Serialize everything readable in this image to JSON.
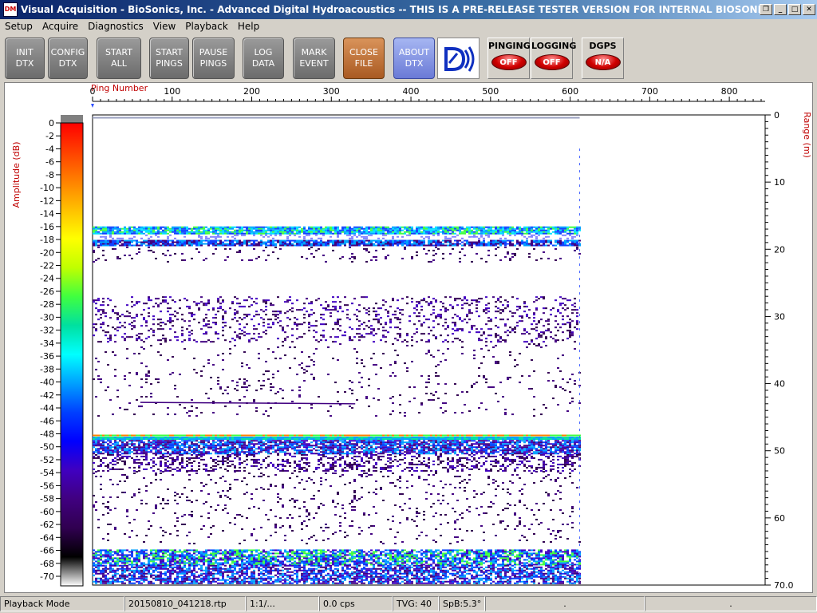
{
  "window": {
    "icon_text": "DM",
    "title": "Visual Acquisition  -  BioSonics, Inc.  -  Advanced Digital Hydroacoustics  -- THIS IS A PRE-RELEASE TESTER VERSION FOR INTERNAL BIOSONICS USE ONLY",
    "buttons": {
      "restore": "❐",
      "minimize": "_",
      "maximize": "□",
      "close": "✕"
    }
  },
  "menu": [
    "Setup",
    "Acquire",
    "Diagnostics",
    "View",
    "Playback",
    "Help"
  ],
  "toolbar": {
    "init": "INIT\nDTX",
    "config": "CONFIG\nDTX",
    "start_all": "START\nALL",
    "start_pings": "START\nPINGS",
    "pause_pings": "PAUSE\nPINGS",
    "log_data": "LOG\nDATA",
    "mark_event": "MARK\nEVENT",
    "close_file": "CLOSE\nFILE",
    "about": "ABOUT\nDTX",
    "pinging": {
      "label": "PINGING",
      "state": "OFF"
    },
    "logging": {
      "label": "LOGGING",
      "state": "OFF"
    },
    "dgps": {
      "label": "DGPS",
      "state": "N/A"
    }
  },
  "echogram": {
    "x_axis_title": "Ping Number",
    "x_ticks": [
      "0",
      "100",
      "200",
      "300",
      "400",
      "500",
      "600",
      "700",
      "800"
    ],
    "x_range": [
      0,
      845
    ],
    "pings_recorded": 612,
    "range_axis_title": "Range (m)",
    "range_ticks": [
      "0",
      "10",
      "20",
      "30",
      "40",
      "50",
      "60",
      "70.0"
    ],
    "range_range": [
      0,
      70
    ],
    "amp_axis_title": "Amplitude (dB)",
    "amp_ticks": [
      "0",
      "-2",
      "-4",
      "-6",
      "-8",
      "-10",
      "-12",
      "-14",
      "-16",
      "-18",
      "-20",
      "-22",
      "-24",
      "-26",
      "-28",
      "-30",
      "-32",
      "-34",
      "-36",
      "-38",
      "-40",
      "-42",
      "-44",
      "-46",
      "-48",
      "-50",
      "-52",
      "-54",
      "-56",
      "-58",
      "-60",
      "-62",
      "-64",
      "-66",
      "-68",
      "-70"
    ],
    "amp_range": [
      0,
      -70
    ],
    "colors": {
      "scale": [
        "#ff0000",
        "#ff4000",
        "#ff8000",
        "#ffc000",
        "#ffff00",
        "#c0ff00",
        "#40ff40",
        "#00e0a0",
        "#00ffff",
        "#00a0ff",
        "#0040ff",
        "#0000ff",
        "#4000c0",
        "#400080",
        "#300050",
        "#000000",
        "#ffffff"
      ]
    }
  },
  "status": {
    "mode": "Playback Mode",
    "file": "20150810_041218.rtp",
    "ratio": "1:1/...",
    "rate": "0.0 cps",
    "tvg": "TVG: 40",
    "spb": "SpB:5.3°",
    "blank1": ".",
    "blank2": "."
  }
}
